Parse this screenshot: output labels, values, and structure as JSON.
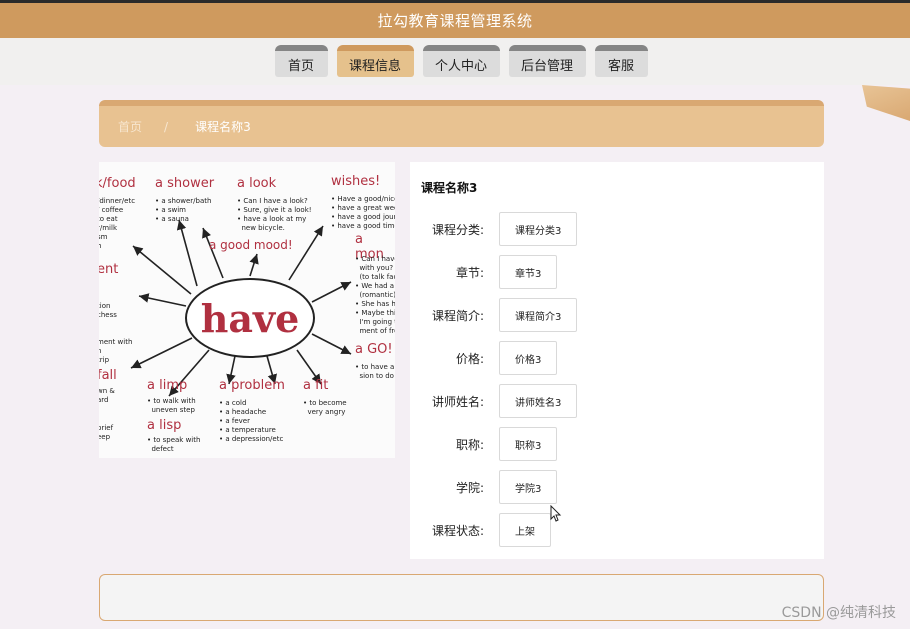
{
  "header": {
    "title": "拉勾教育课程管理系统"
  },
  "nav": [
    {
      "label": "首页",
      "active": false
    },
    {
      "label": "课程信息",
      "active": true
    },
    {
      "label": "个人中心",
      "active": false
    },
    {
      "label": "后台管理",
      "active": false
    },
    {
      "label": "客服",
      "active": false
    }
  ],
  "breadcrumb": {
    "home": "首页",
    "separator": "/",
    "current": "课程名称3"
  },
  "image": {
    "center_word": "have",
    "headings": [
      "k/food",
      "a shower",
      "a look",
      "wishes!",
      "a good mood!",
      "a mon",
      "ent",
      "a GO!",
      "fall",
      "a limp",
      "a problem",
      "a fit",
      "a lisp"
    ],
    "notes": {
      "food": "/dinner/etc\n/ coffee\nto eat\nr/milk\nsm\nh",
      "shower": "• a shower/bath\n• a swim\n• a sauna",
      "look": "• Can I have a look?\n• Sure, give it a look!\n• have a look at my\n  new bicycle.",
      "wishes": "• Have a good/nice\n• have a great wee\n• have a good jour\n• have a good time",
      "mon": "• Can I have\n  with you?\n  (to talk face\n• We had a\n  (romantic)\n• She has he\n• Maybe this\n  I'm going to\n  ment of fre",
      "ent": "tion\nchess",
      "go": "• to have a p\n  sion to do s",
      "left_mid": "ment with\nn\ntrip",
      "fall": "wn &\nard",
      "left_bottom": "brief\neep",
      "limp": "• to walk with\n  uneven step",
      "lisp": "• to speak with\n  defect",
      "problem": "• a cold\n• a headache\n• a fever\n• a temperature\n• a depression/etc",
      "fit": "• to become\n  very angry"
    }
  },
  "detail": {
    "title": "课程名称3",
    "fields": [
      {
        "label": "课程分类:",
        "value": "课程分类3"
      },
      {
        "label": "章节:",
        "value": "章节3"
      },
      {
        "label": "课程简介:",
        "value": "课程简介3"
      },
      {
        "label": "价格:",
        "value": "价格3"
      },
      {
        "label": "讲师姓名:",
        "value": "讲师姓名3"
      },
      {
        "label": "职称:",
        "value": "职称3"
      },
      {
        "label": "学院:",
        "value": "学院3"
      },
      {
        "label": "课程状态:",
        "value": "上架"
      }
    ]
  },
  "watermark": "CSDN @纯清科技",
  "colors": {
    "header": "#cf9a5e",
    "accent": "#e8c291",
    "nav_inactive": "#dcdcdc"
  }
}
